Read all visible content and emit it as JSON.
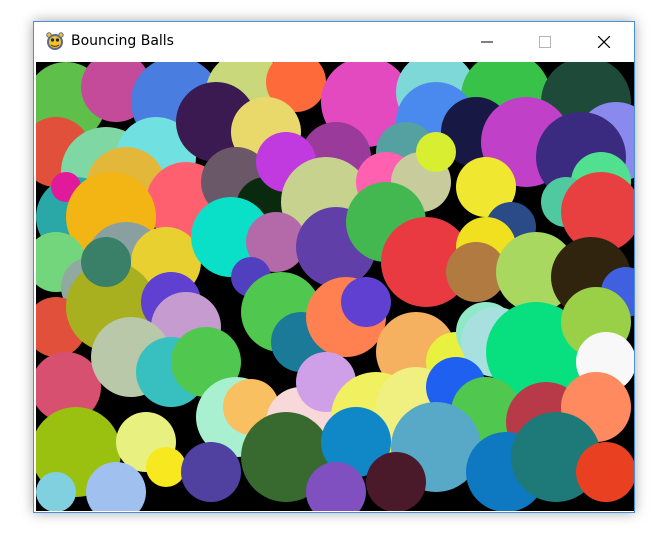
{
  "window": {
    "title": "Bouncing Balls",
    "app_icon": "pygame-snake-icon",
    "controls": {
      "minimize": "minimize-icon",
      "maximize": "maximize-icon",
      "close": "close-icon"
    },
    "border_color": "#4a90d9"
  },
  "canvas": {
    "background": "#000000"
  }
}
